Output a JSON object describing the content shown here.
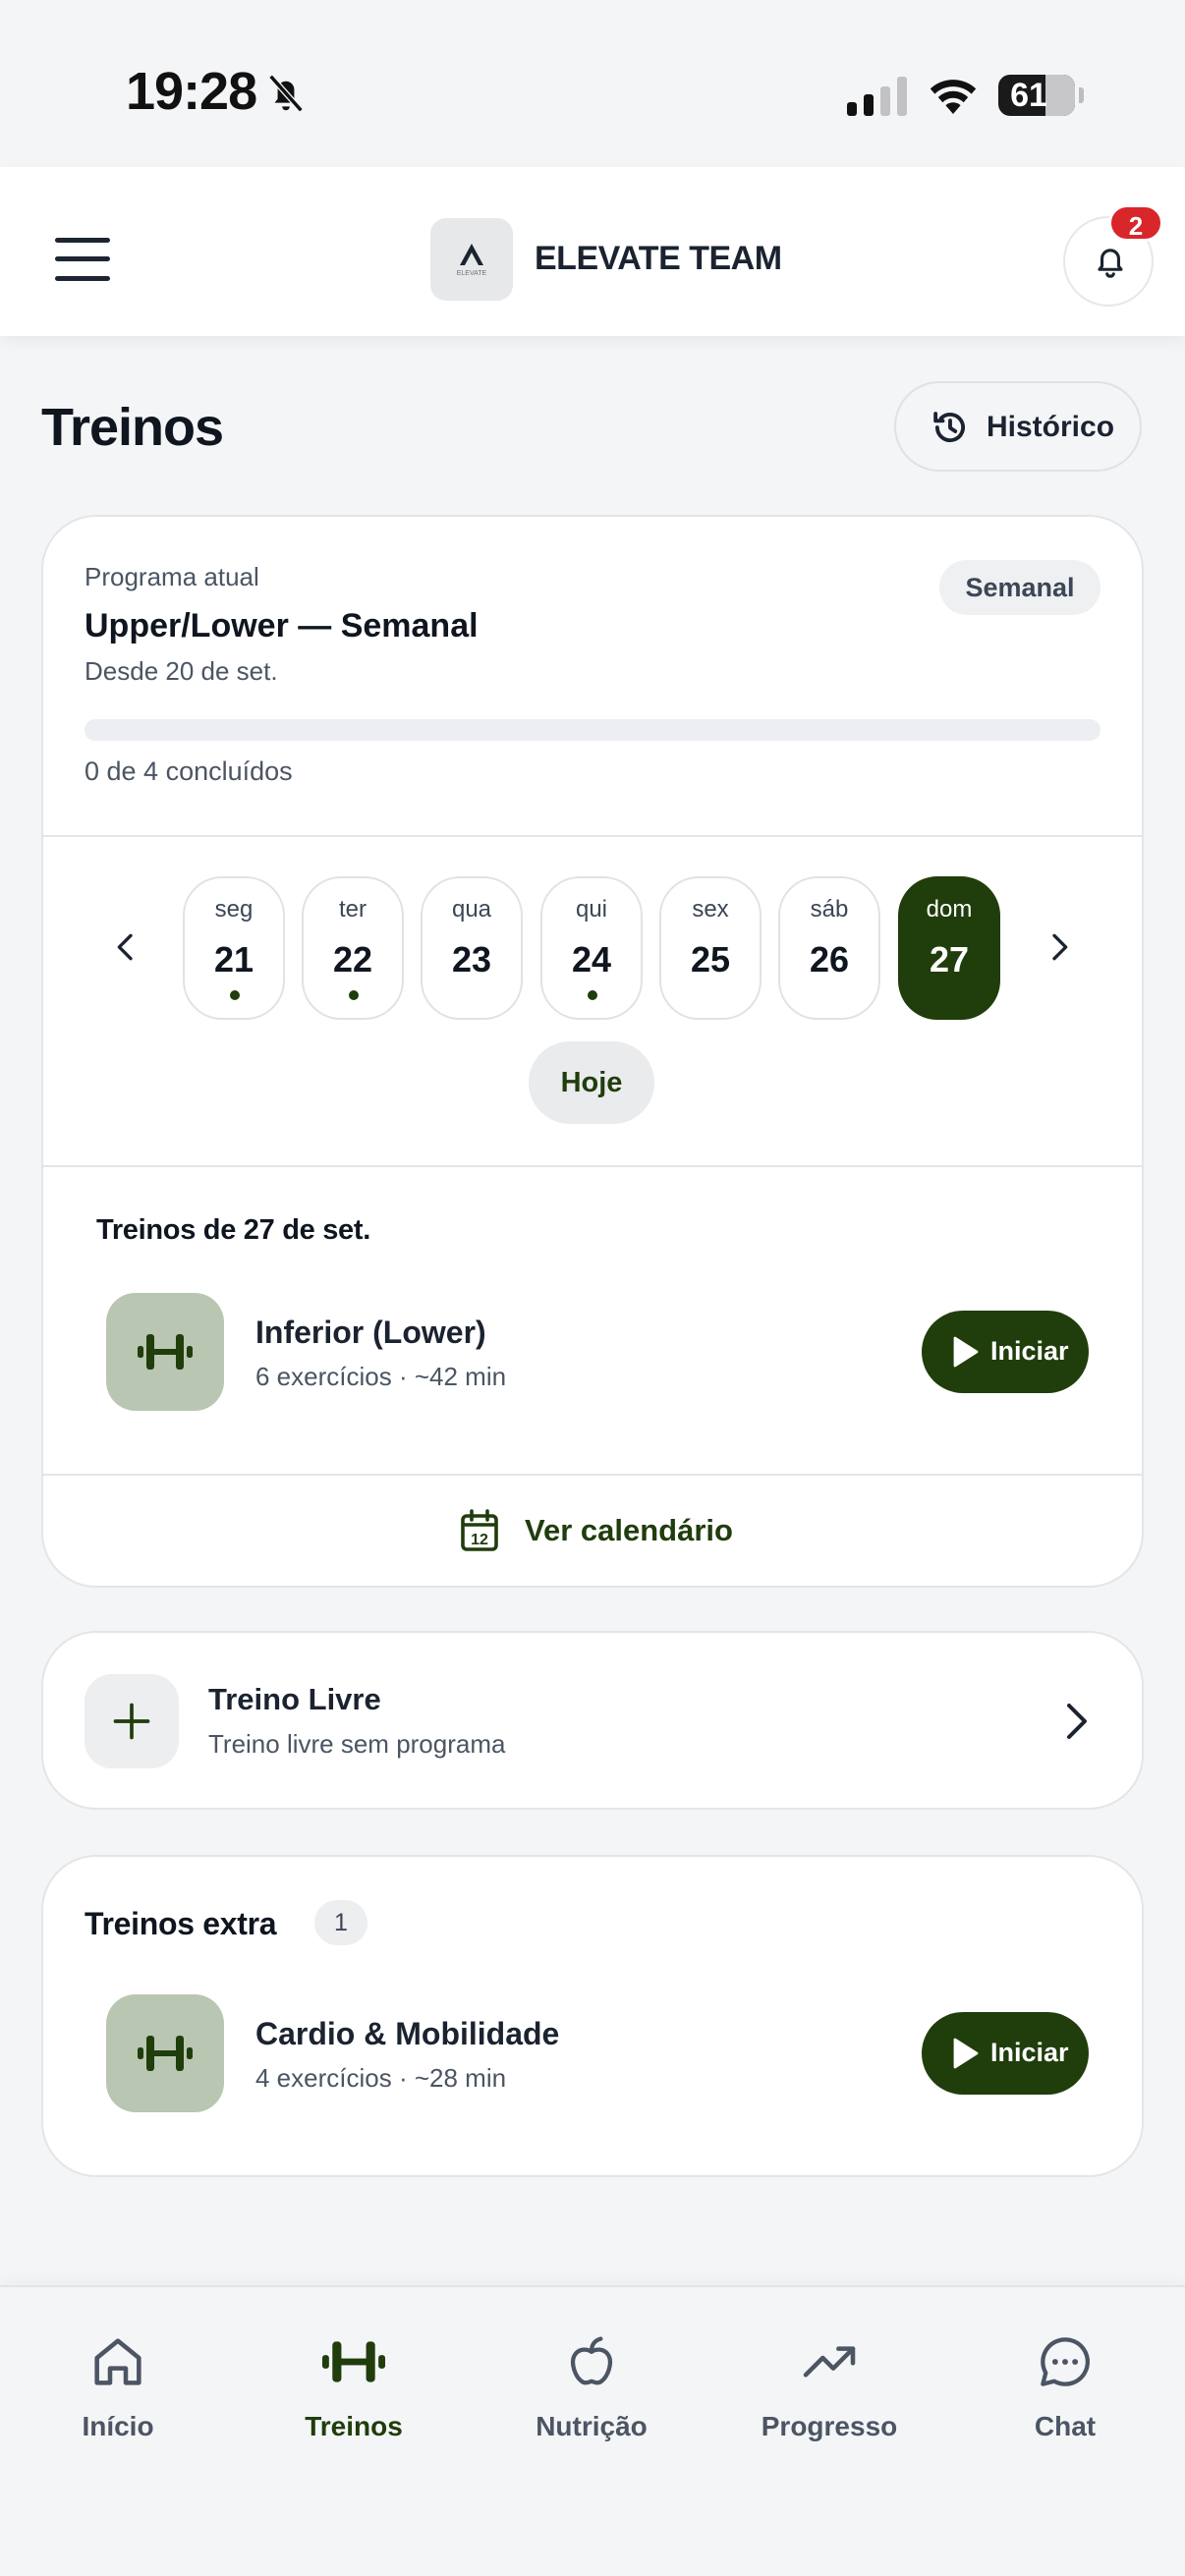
{
  "status_bar": {
    "time": "19:28",
    "battery": "61"
  },
  "header": {
    "brand": "ELEVATE TEAM",
    "logo_text": "ELEVATE",
    "notifications_count": "2"
  },
  "page": {
    "title": "Treinos",
    "history_label": "Histórico"
  },
  "program": {
    "label": "Programa atual",
    "name": "Upper/Lower — Semanal",
    "since": "Desde 20 de set.",
    "frequency": "Semanal",
    "progress_text": "0 de 4 concluídos",
    "progress_fraction": 0
  },
  "week": {
    "days": [
      {
        "name": "seg",
        "num": "21",
        "has_workout": true,
        "active": false
      },
      {
        "name": "ter",
        "num": "22",
        "has_workout": true,
        "active": false
      },
      {
        "name": "qua",
        "num": "23",
        "has_workout": false,
        "active": false
      },
      {
        "name": "qui",
        "num": "24",
        "has_workout": true,
        "active": false
      },
      {
        "name": "sex",
        "num": "25",
        "has_workout": false,
        "active": false
      },
      {
        "name": "sáb",
        "num": "26",
        "has_workout": false,
        "active": false
      },
      {
        "name": "dom",
        "num": "27",
        "has_workout": false,
        "active": true
      }
    ],
    "today_label": "Hoje"
  },
  "day_workouts": {
    "title": "Treinos de 27 de set.",
    "items": [
      {
        "name": "Inferior (Lower)",
        "meta": "6 exercícios · ~42 min",
        "action": "Iniciar"
      }
    ]
  },
  "calendar_link": "Ver calendário",
  "free_workout": {
    "title": "Treino Livre",
    "subtitle": "Treino livre sem programa"
  },
  "extra": {
    "title": "Treinos extra",
    "count": "1",
    "items": [
      {
        "name": "Cardio & Mobilidade",
        "meta": "4 exercícios · ~28 min",
        "action": "Iniciar"
      }
    ]
  },
  "bottom_nav": [
    {
      "label": "Início",
      "icon": "home-icon",
      "active": false
    },
    {
      "label": "Treinos",
      "icon": "dumbbell-icon",
      "active": true
    },
    {
      "label": "Nutrição",
      "icon": "apple-icon",
      "active": false
    },
    {
      "label": "Progresso",
      "icon": "trending-up-icon",
      "active": false
    },
    {
      "label": "Chat",
      "icon": "chat-icon",
      "active": false
    }
  ],
  "colors": {
    "accent": "#203d0c",
    "badge": "#d8262b",
    "thumb": "#b9c6b1"
  }
}
